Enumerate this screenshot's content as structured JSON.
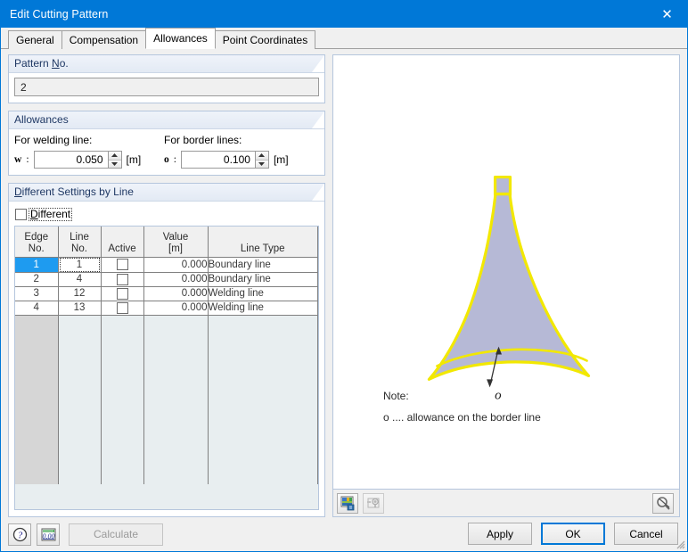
{
  "window": {
    "title": "Edit Cutting Pattern",
    "close_icon": "close-icon"
  },
  "tabs": [
    {
      "label": "General",
      "active": false
    },
    {
      "label": "Compensation",
      "active": false
    },
    {
      "label": "Allowances",
      "active": true
    },
    {
      "label": "Point Coordinates",
      "active": false
    }
  ],
  "pattern_no": {
    "group_title_pre": "Pattern ",
    "group_title_key": "N",
    "group_title_post": "o.",
    "value": "2"
  },
  "allowances": {
    "group_title": "Allowances",
    "welding": {
      "label": "For welding line:",
      "symbol": "w",
      "colon": ":",
      "value": "0.050",
      "unit": "[m]"
    },
    "border": {
      "label": "For border lines:",
      "symbol": "o",
      "colon": ":",
      "value": "0.100",
      "unit": "[m]"
    }
  },
  "different_settings": {
    "group_title_key": "D",
    "group_title_rest": "ifferent Settings by Line",
    "checkbox_label_key": "D",
    "checkbox_label_rest": "ifferent",
    "checkbox_checked": false,
    "columns": [
      {
        "line1": "Edge",
        "line2": "No."
      },
      {
        "line1": "Line",
        "line2": "No."
      },
      {
        "line1": "",
        "line2": "Active"
      },
      {
        "line1": "Value",
        "line2": "[m]"
      },
      {
        "line1": "",
        "line2": "Line Type"
      }
    ],
    "rows": [
      {
        "edge": "1",
        "line": "1",
        "active": false,
        "value": "0.000",
        "type": "Boundary line",
        "selected": true
      },
      {
        "edge": "2",
        "line": "4",
        "active": false,
        "value": "0.000",
        "type": "Boundary line",
        "selected": false
      },
      {
        "edge": "3",
        "line": "12",
        "active": false,
        "value": "0.000",
        "type": "Welding line",
        "selected": false
      },
      {
        "edge": "4",
        "line": "13",
        "active": false,
        "value": "0.000",
        "type": "Welding line",
        "selected": false
      }
    ]
  },
  "graphics": {
    "shape_fill": "#b6b9d6",
    "shape_outline": "#f2e800",
    "dimension_label": "o",
    "note_title": "Note:",
    "note_line": "o .... allowance on the border line",
    "toolbar": {
      "render_icon": "render-image-icon",
      "print_preview_icon": "print-preview-icon",
      "zoom_reset_icon": "zoom-reset-icon"
    }
  },
  "footer": {
    "help_icon": "help-icon",
    "units_icon": "units-icon",
    "calculate_label": "Calculate",
    "calculate_disabled": true,
    "apply_label": "Apply",
    "ok_label": "OK",
    "cancel_label": "Cancel"
  }
}
